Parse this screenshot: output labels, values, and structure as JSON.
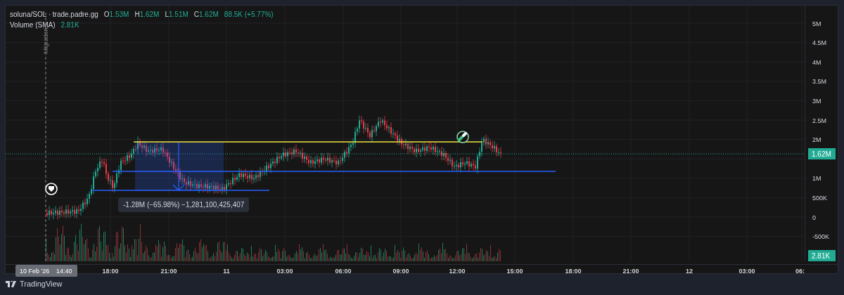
{
  "header": {
    "symbol": "soluna/SOL · trade.padre.gg",
    "ohlc": [
      {
        "label": "O",
        "value": "1.53M"
      },
      {
        "label": "H",
        "value": "1.62M"
      },
      {
        "label": "L",
        "value": "1.51M"
      },
      {
        "label": "C",
        "value": "1.62M"
      }
    ],
    "change": "88.5K (+5.77%)"
  },
  "indicator": {
    "name": "Volume (SMA)",
    "value": "2.81K"
  },
  "chart": {
    "event_label": "Migration",
    "measure_label": "-1.28M (−65.98%) −1,281,100,425,407"
  },
  "price_axis": {
    "ticks": [
      "5M",
      "4.5M",
      "4M",
      "3.5M",
      "3M",
      "2.5M",
      "2M",
      "1M",
      "500K",
      "0",
      "-500K"
    ],
    "current_price": "1.62M",
    "volume_value": "2.81K"
  },
  "time_axis": {
    "cursor_date": "10 Feb '26",
    "cursor_time": "14:40",
    "ticks": [
      "18:00",
      "21:00",
      "11",
      "03:00",
      "06:00",
      "09:00",
      "12:00",
      "15:00",
      "18:00",
      "21:00",
      "12",
      "03:00",
      "06:"
    ]
  },
  "footer": {
    "brand": "TradingView"
  }
}
